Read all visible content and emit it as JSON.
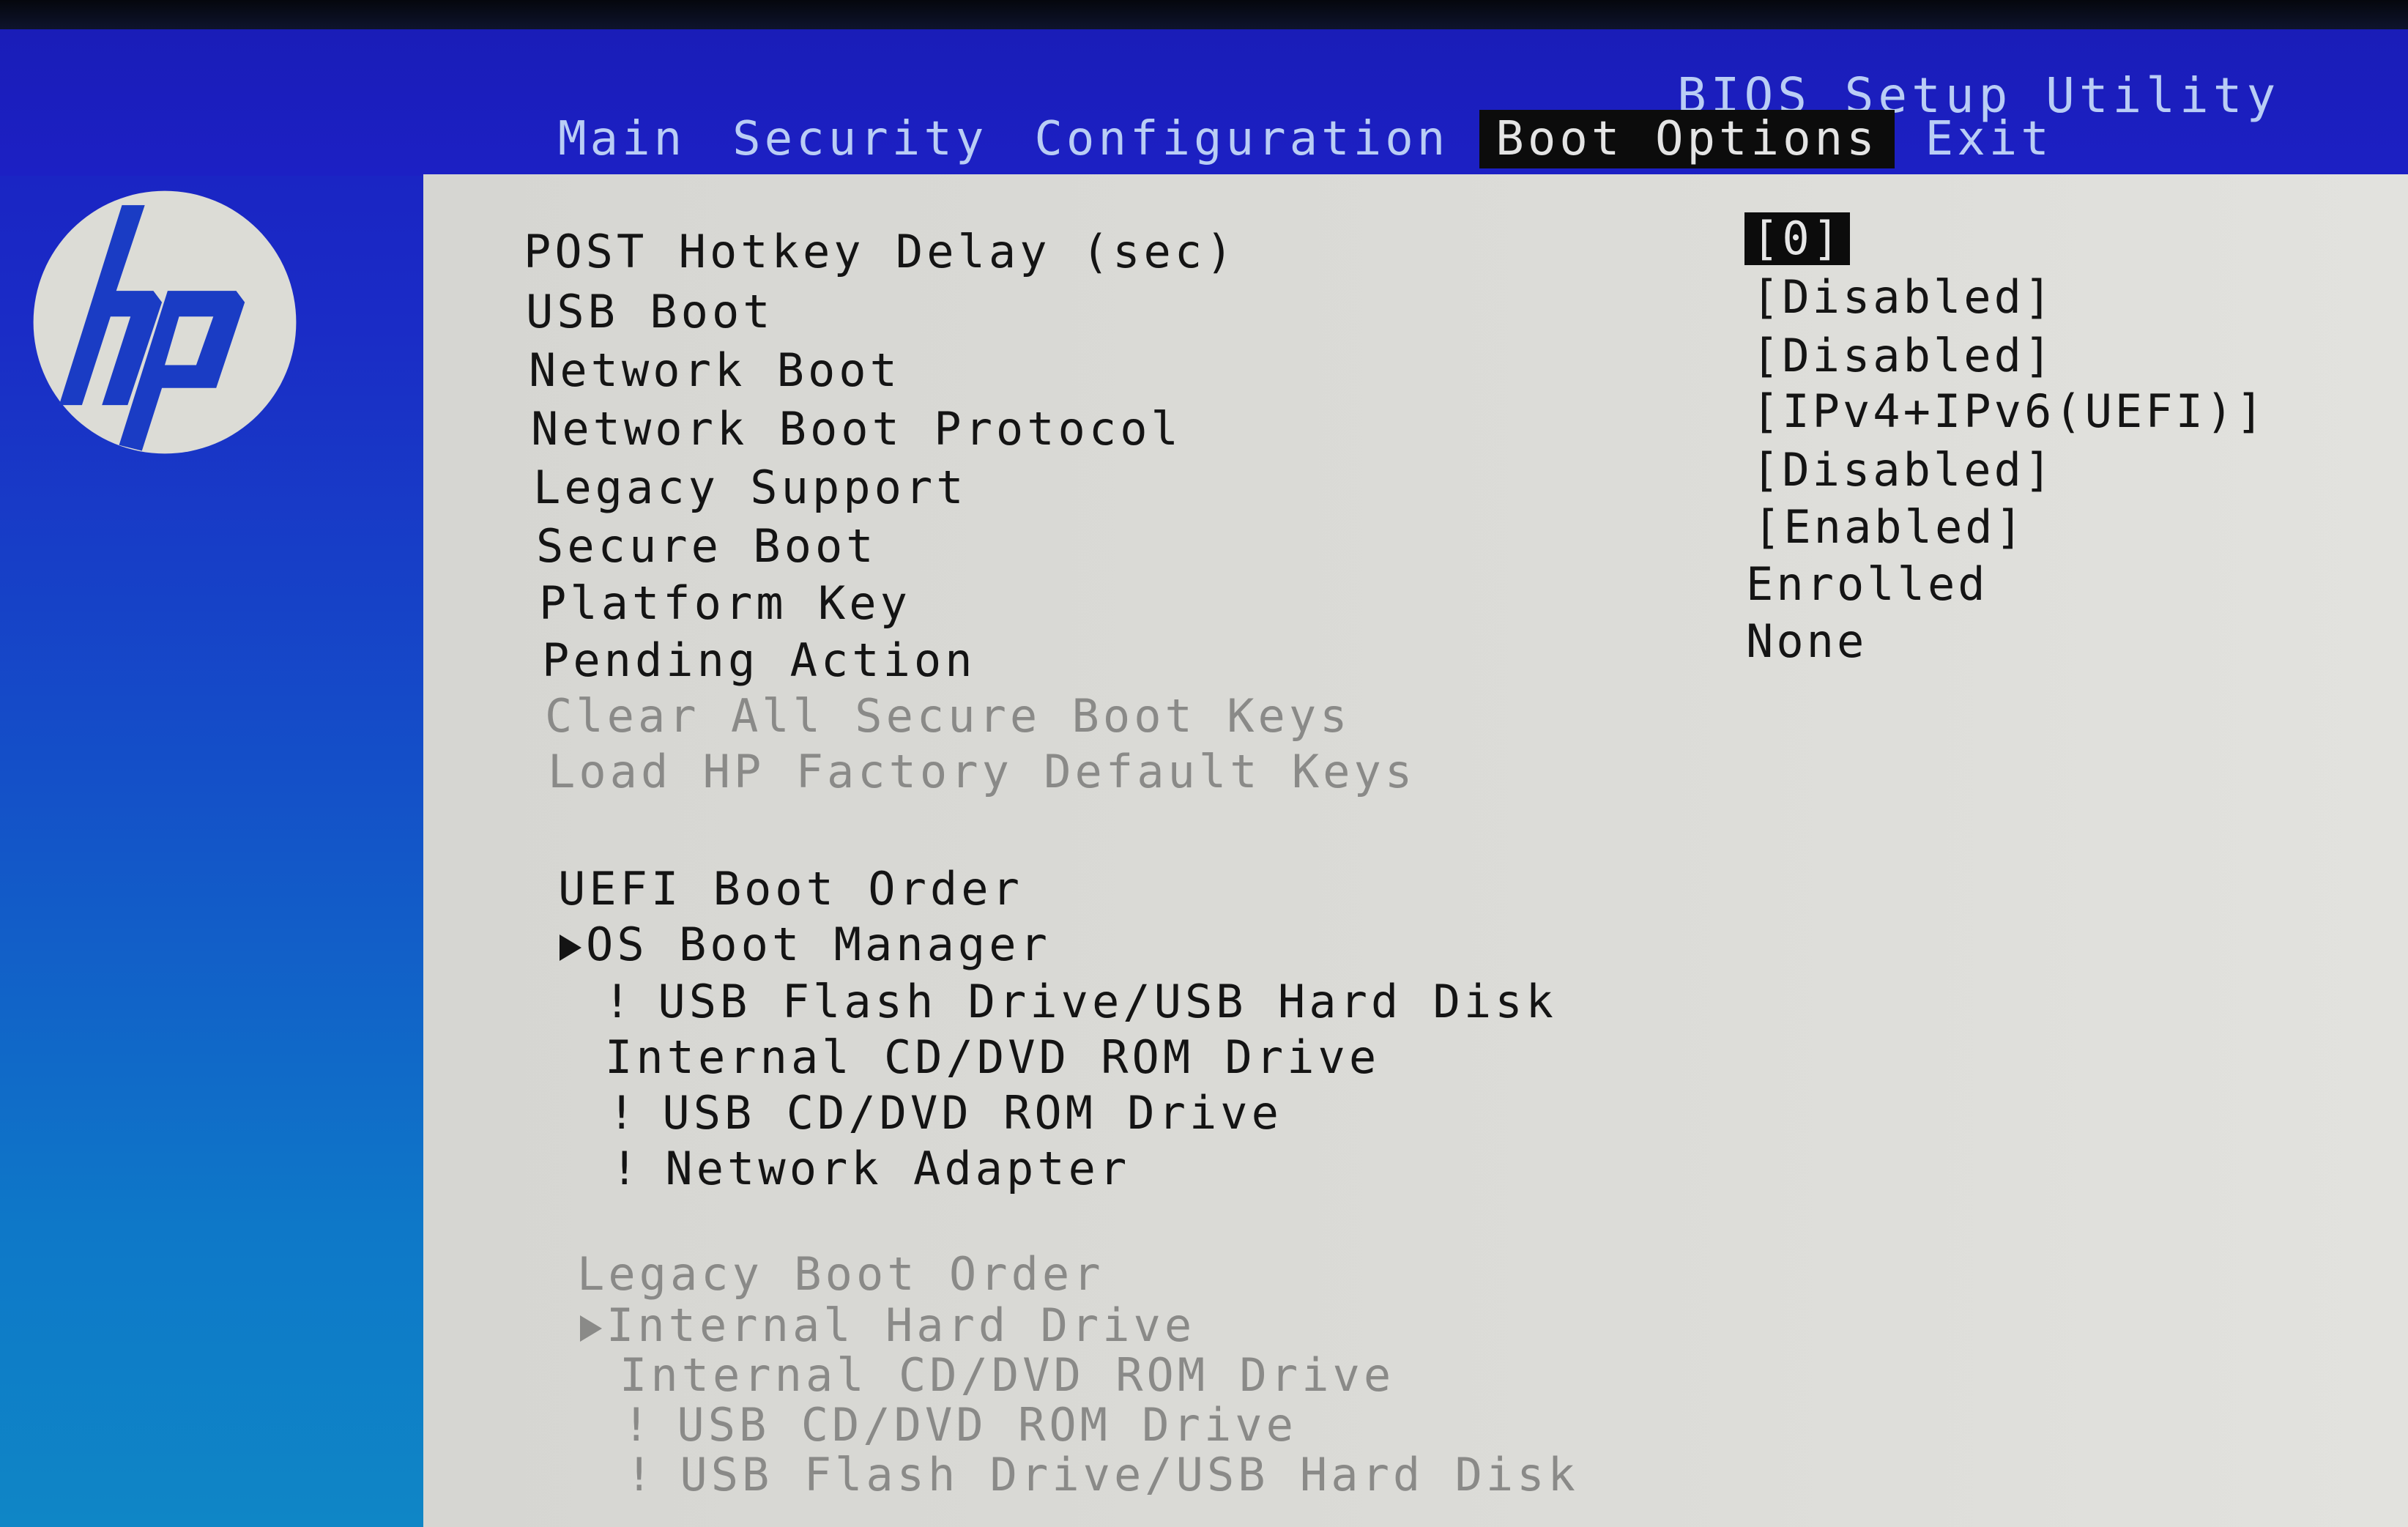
{
  "header": {
    "app_title": "BIOS Setup Utility",
    "tabs": [
      {
        "label": "Main",
        "active": false
      },
      {
        "label": "Security",
        "active": false
      },
      {
        "label": "Configuration",
        "active": false
      },
      {
        "label": "Boot Options",
        "active": true
      },
      {
        "label": "Exit",
        "active": false
      }
    ]
  },
  "brand": {
    "logo": "hp-logo",
    "colors": {
      "header_blue": "#1c20c4",
      "panel_gray": "#dcdcd8",
      "highlight_black": "#0c0c0c",
      "disabled_text": "#8a8a88"
    }
  },
  "settings": [
    {
      "label": "POST Hotkey Delay (sec)",
      "value": "[0]",
      "selected": true
    },
    {
      "label": "USB Boot",
      "value": "[Disabled]"
    },
    {
      "label": "Network Boot",
      "value": "[Disabled]"
    },
    {
      "label": "Network Boot Protocol",
      "value": "[IPv4+IPv6(UEFI)]"
    },
    {
      "label": "Legacy Support",
      "value": "[Disabled]"
    },
    {
      "label": "Secure Boot",
      "value": "[Enabled]"
    },
    {
      "label": "Platform Key",
      "value": "Enrolled"
    },
    {
      "label": "Pending Action",
      "value": "None"
    }
  ],
  "actions": [
    {
      "label": "Clear All Secure Boot Keys",
      "disabled": true
    },
    {
      "label": "Load HP Factory Default Keys",
      "disabled": true
    }
  ],
  "uefi_boot_order": {
    "title": "UEFI Boot Order",
    "items": [
      {
        "prefix": "",
        "label": "OS Boot Manager",
        "current": true
      },
      {
        "prefix": "!",
        "label": "USB Flash Drive/USB Hard Disk"
      },
      {
        "prefix": "",
        "label": "Internal CD/DVD ROM Drive"
      },
      {
        "prefix": "!",
        "label": "USB CD/DVD ROM Drive"
      },
      {
        "prefix": "!",
        "label": "Network Adapter"
      }
    ]
  },
  "legacy_boot_order": {
    "title": "Legacy Boot Order",
    "disabled": true,
    "items": [
      {
        "prefix": "",
        "label": "Internal Hard Drive",
        "current": true
      },
      {
        "prefix": "",
        "label": "Internal CD/DVD ROM Drive"
      },
      {
        "prefix": "!",
        "label": "USB CD/DVD ROM Drive"
      },
      {
        "prefix": "!",
        "label": "USB Flash Drive/USB Hard Disk"
      }
    ]
  }
}
